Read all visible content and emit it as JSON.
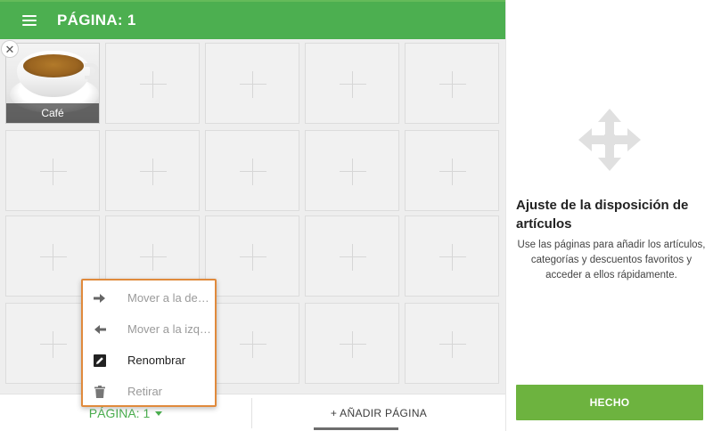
{
  "header": {
    "title": "PÁGINA: 1",
    "menu_icon": "hamburger-menu-icon",
    "color": "#4caf50"
  },
  "grid": {
    "item": {
      "label": "Café",
      "remove_symbol": "✕"
    }
  },
  "context_menu": {
    "items": [
      {
        "label": "Mover a la derecha",
        "icon": "arrow-right-icon",
        "enabled": false
      },
      {
        "label": "Mover a la izquierda",
        "icon": "arrow-left-icon",
        "enabled": false
      },
      {
        "label": "Renombrar",
        "icon": "edit-icon",
        "enabled": true
      },
      {
        "label": "Retirar",
        "icon": "trash-icon",
        "enabled": false
      }
    ],
    "border_color": "#e08a3c"
  },
  "bottom_bar": {
    "page_selector": "PÁGINA: 1",
    "add_page": "+ AÑADIR PÁGINA"
  },
  "side_panel": {
    "icon": "move-arrows-icon",
    "title": "Ajuste de la disposición de artículos",
    "description": "Use las páginas para añadir los artículos, categorías y descuentos favoritos y acceder a ellos rápidamente.",
    "done_button": "HECHO",
    "done_color": "#6db33f"
  }
}
